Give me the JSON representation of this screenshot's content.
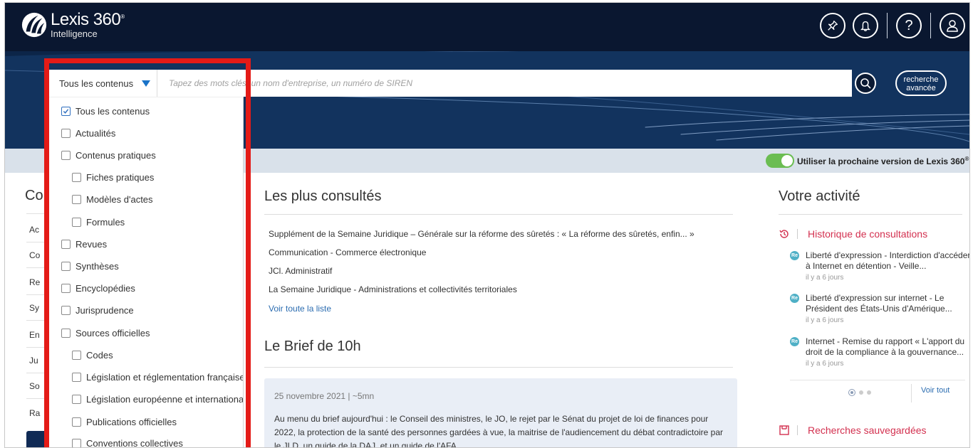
{
  "header": {
    "logo_title": "Lexis 360",
    "logo_registered": "®",
    "logo_subtitle": "Intelligence"
  },
  "search": {
    "scope_label": "Tous les contenus",
    "placeholder": "Tapez des mots clés, un nom d'entreprise, un numéro de SIREN",
    "advanced_line1": "recherche",
    "advanced_line2": "avancée"
  },
  "toggle": {
    "label": "Utiliser la prochaine version de Lexis 360",
    "sup": "®",
    "state": "on"
  },
  "dropdown": {
    "options": [
      {
        "label": "Tous les contenus",
        "checked": true,
        "indent": 0
      },
      {
        "label": "Actualités",
        "checked": false,
        "indent": 0
      },
      {
        "label": "Contenus pratiques",
        "checked": false,
        "indent": 0
      },
      {
        "label": "Fiches pratiques",
        "checked": false,
        "indent": 1
      },
      {
        "label": "Modèles d'actes",
        "checked": false,
        "indent": 1
      },
      {
        "label": "Formules",
        "checked": false,
        "indent": 1
      },
      {
        "label": "Revues",
        "checked": false,
        "indent": 0
      },
      {
        "label": "Synthèses",
        "checked": false,
        "indent": 0
      },
      {
        "label": "Encyclopédies",
        "checked": false,
        "indent": 0
      },
      {
        "label": "Jurisprudence",
        "checked": false,
        "indent": 0
      },
      {
        "label": "Sources officielles",
        "checked": false,
        "indent": 0
      },
      {
        "label": "Codes",
        "checked": false,
        "indent": 1
      },
      {
        "label": "Législation et réglementation françaises",
        "checked": false,
        "indent": 1
      },
      {
        "label": "Législation européenne et internationale",
        "checked": false,
        "indent": 1
      },
      {
        "label": "Publications officielles",
        "checked": false,
        "indent": 1
      },
      {
        "label": "Conventions collectives",
        "checked": false,
        "indent": 1
      }
    ]
  },
  "left": {
    "heading": "Co",
    "items": [
      "Ac",
      "Co",
      "Re",
      "Sy",
      "En",
      "Ju",
      "So",
      "Ra"
    ]
  },
  "most_viewed": {
    "title": "Les plus consultés",
    "items": [
      "Supplément de la Semaine Juridique – Générale sur la réforme des sûretés : « La réforme des sûretés, enfin... »",
      "Communication - Commerce électronique",
      "JCl. Administratif",
      "La Semaine Juridique - Administrations et collectivités territoriales"
    ],
    "see_all": "Voir toute la liste"
  },
  "brief": {
    "title": "Le Brief de 10h",
    "date": "25 novembre 2021 | ~5mn",
    "text": "Au menu du brief aujourd'hui : le Conseil des ministres, le JO, le rejet par le Sénat du projet de loi de finances pour 2022, la protection de la santé des personnes gardées à vue, la maitrise de l'audiencement du débat contradictoire par le JLD, un guide de la DAJ, et un guide de l'AFA"
  },
  "activity": {
    "title": "Votre activité",
    "history_label": "Historique de consultations",
    "items": [
      {
        "badge": "Re",
        "title": "Liberté d'expression - Interdiction d'accéder à Internet en détention - Veille...",
        "time": "il y a 6 jours"
      },
      {
        "badge": "Re",
        "title": "Liberté d'expression sur internet - Le Président des États-Unis d'Amérique...",
        "time": "il y a 6 jours"
      },
      {
        "badge": "Re",
        "title": "Internet - Remise du rapport « L'apport du droit de la compliance à la gouvernance...",
        "time": "il y a 6 jours"
      }
    ],
    "see_all": "Voir tout",
    "saved_label": "Recherches sauvegardées"
  }
}
